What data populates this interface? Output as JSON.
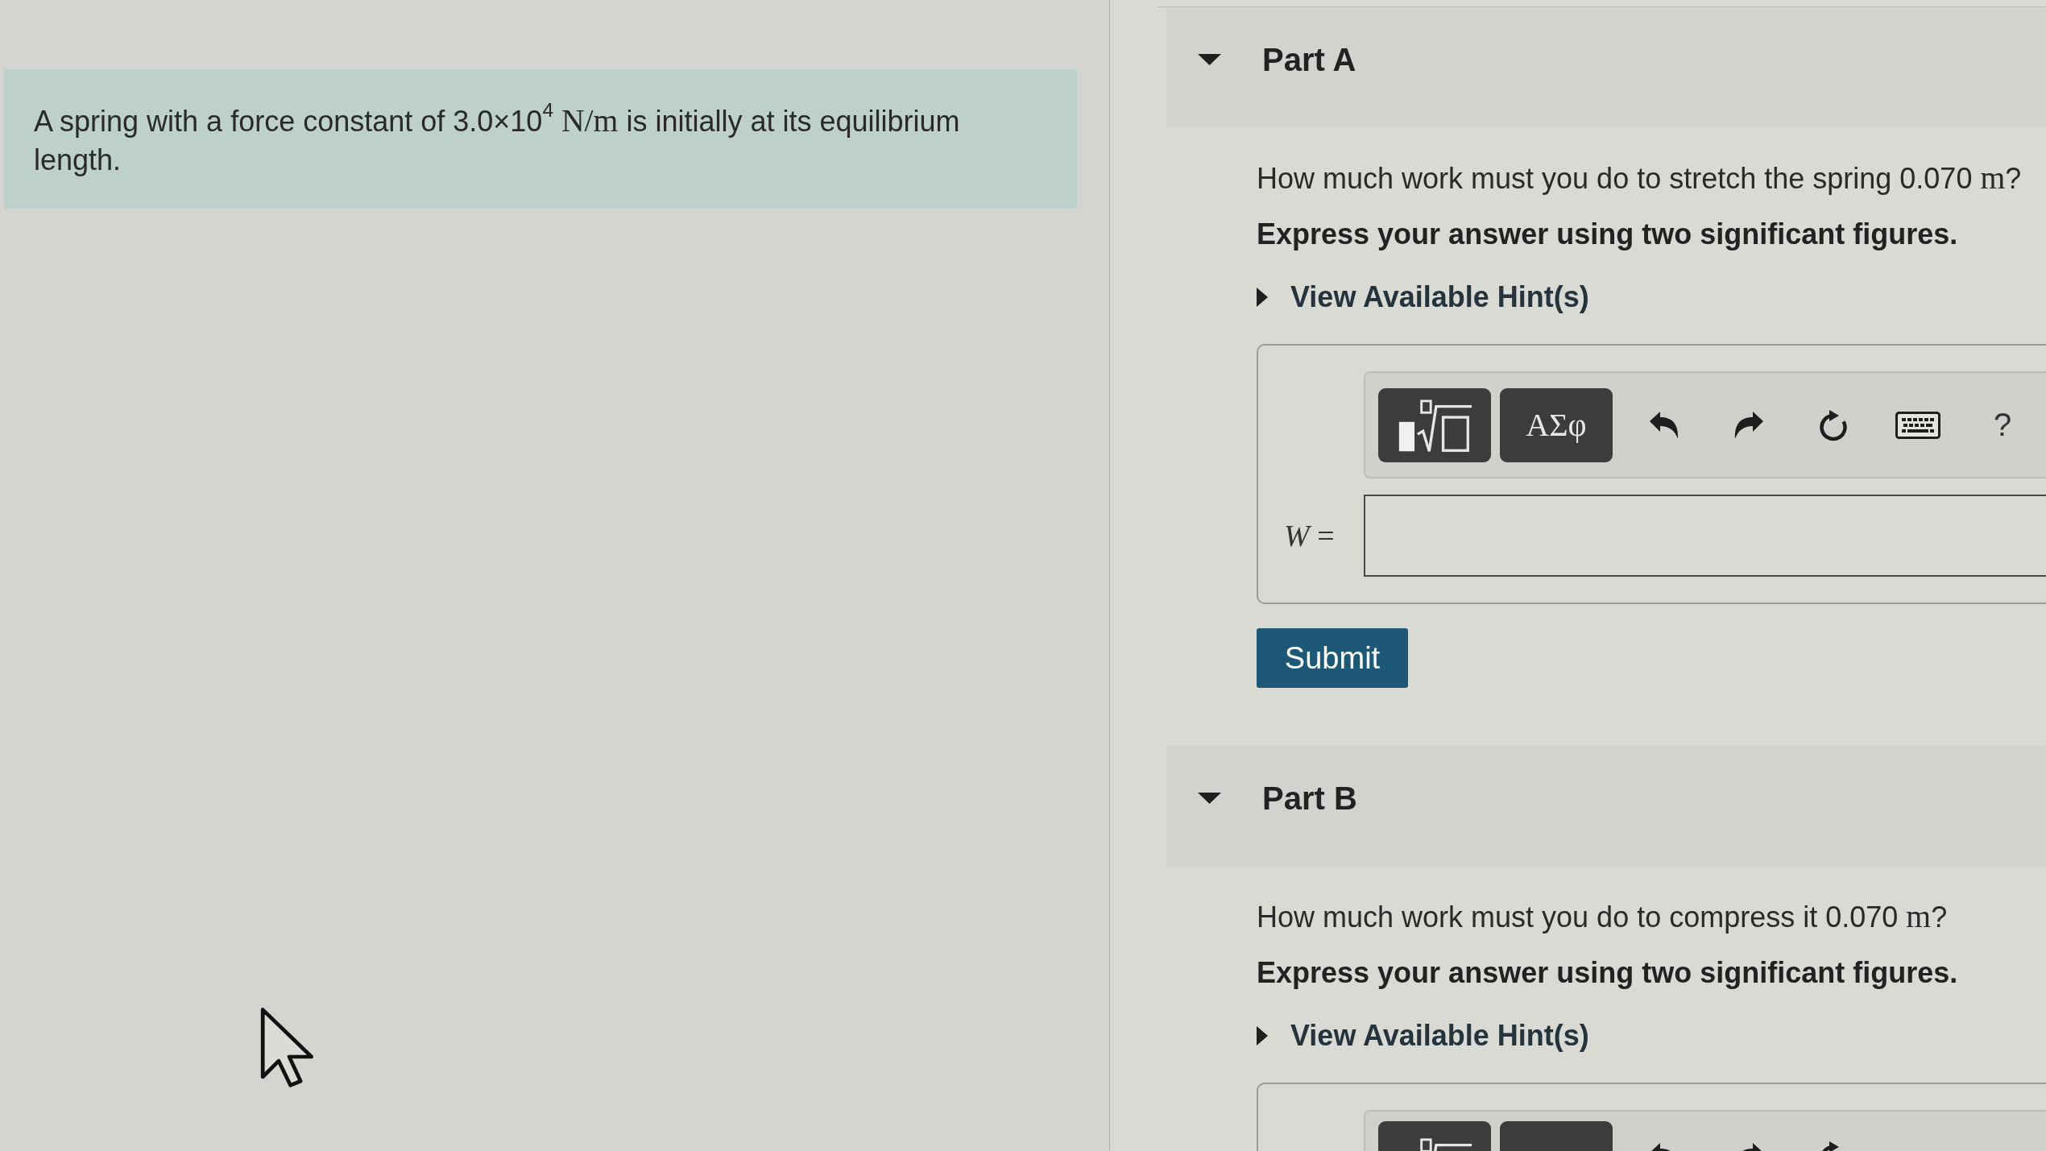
{
  "problem": {
    "text": [
      {
        "kind": "plain",
        "text": "A spring with a force constant of 3.0×10$^{4}$ "
      },
      {
        "kind": "math",
        "text": "N/m"
      },
      {
        "kind": "plain",
        "text": " is initially at its equilibrium length."
      }
    ]
  },
  "parts": [
    {
      "label": "Part A",
      "expanded": true,
      "question": [
        {
          "kind": "plain",
          "text": "How much work must you do to stretch the spring 0.070 "
        },
        {
          "kind": "math",
          "text": "m"
        },
        {
          "kind": "plain",
          "text": "?"
        }
      ],
      "instruction": "Express your answer using two significant figures.",
      "hints": {
        "label": "View Available Hint(s)",
        "expanded": false
      },
      "answer": {
        "cropped": false,
        "toolbar": [
          {
            "kind": "template"
          },
          {
            "kind": "symbols",
            "label": "ΑΣφ"
          },
          {
            "kind": "undo"
          },
          {
            "kind": "redo"
          },
          {
            "kind": "reset"
          },
          {
            "kind": "keyboard"
          },
          {
            "kind": "help",
            "label": "?"
          }
        ],
        "label": "*W* ="
      },
      "submit": {
        "label": "Submit"
      }
    },
    {
      "label": "Part B",
      "expanded": true,
      "question": [
        {
          "kind": "plain",
          "text": "How much work must you do to compress it 0.070 "
        },
        {
          "kind": "math",
          "text": "m"
        },
        {
          "kind": "plain",
          "text": "?"
        }
      ],
      "instruction": "Express your answer using two significant figures.",
      "hints": {
        "label": "View Available Hint(s)",
        "expanded": false
      },
      "answer": {
        "cropped": true,
        "toolbar": [
          {
            "kind": "template"
          },
          {
            "kind": "symbols"
          },
          {
            "kind": "undo"
          },
          {
            "kind": "redo"
          },
          {
            "kind": "reset"
          }
        ]
      }
    }
  ]
}
